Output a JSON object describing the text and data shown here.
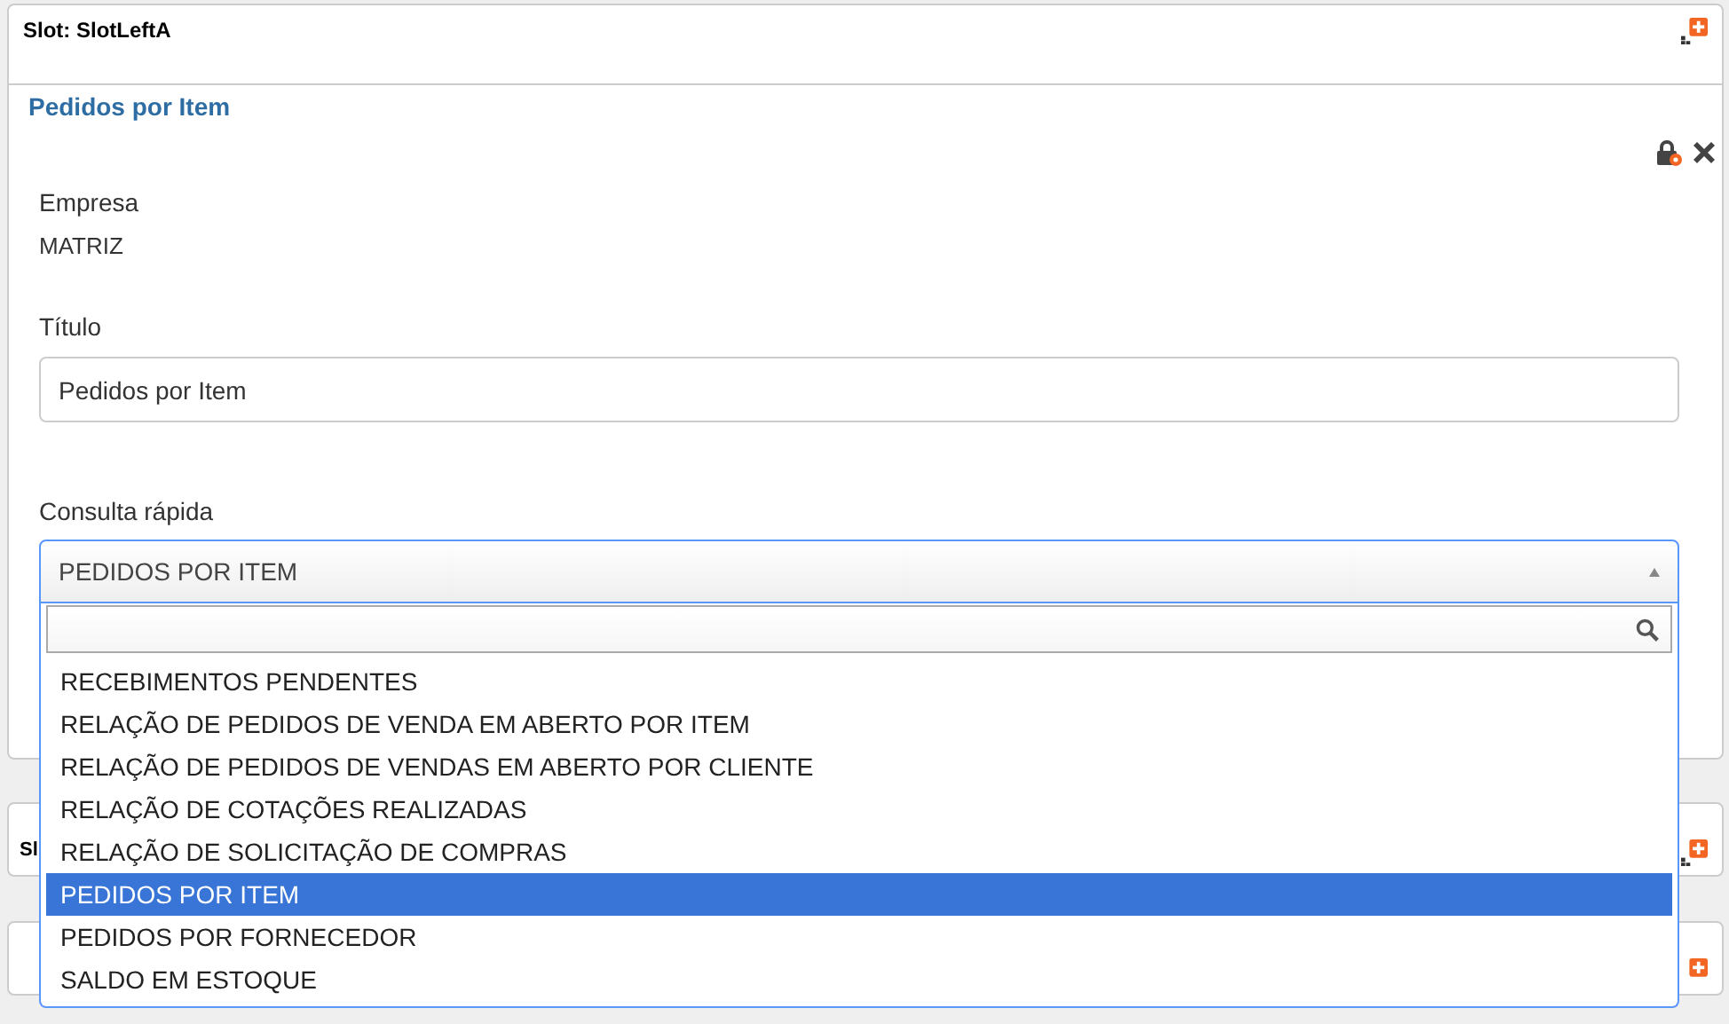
{
  "slots": [
    {
      "title": "Slot: SlotLeftA"
    },
    {
      "title": "Sl"
    }
  ],
  "portlet": {
    "title": "Pedidos por Item",
    "empresa": {
      "label": "Empresa",
      "value": "MATRIZ"
    },
    "titulo": {
      "label": "Título",
      "value": "Pedidos por Item"
    },
    "consulta": {
      "label": "Consulta rápida",
      "value": "PEDIDOS POR ITEM",
      "expanded": true,
      "options": [
        {
          "label": "RECEBIMENTOS PENDENTES",
          "selected": false
        },
        {
          "label": "RELAÇÃO DE PEDIDOS DE VENDA EM ABERTO POR ITEM",
          "selected": false
        },
        {
          "label": "RELAÇÃO DE PEDIDOS DE VENDAS EM ABERTO POR CLIENTE",
          "selected": false
        },
        {
          "label": "RELAÇÃO DE COTAÇÕES REALIZADAS",
          "selected": false
        },
        {
          "label": "RELAÇÃO DE SOLICITAÇÃO DE COMPRAS",
          "selected": false
        },
        {
          "label": "PEDIDOS POR ITEM",
          "selected": true
        },
        {
          "label": "PEDIDOS POR FORNECEDOR",
          "selected": false
        },
        {
          "label": "SALDO EM ESTOQUE",
          "selected": false
        }
      ]
    }
  }
}
